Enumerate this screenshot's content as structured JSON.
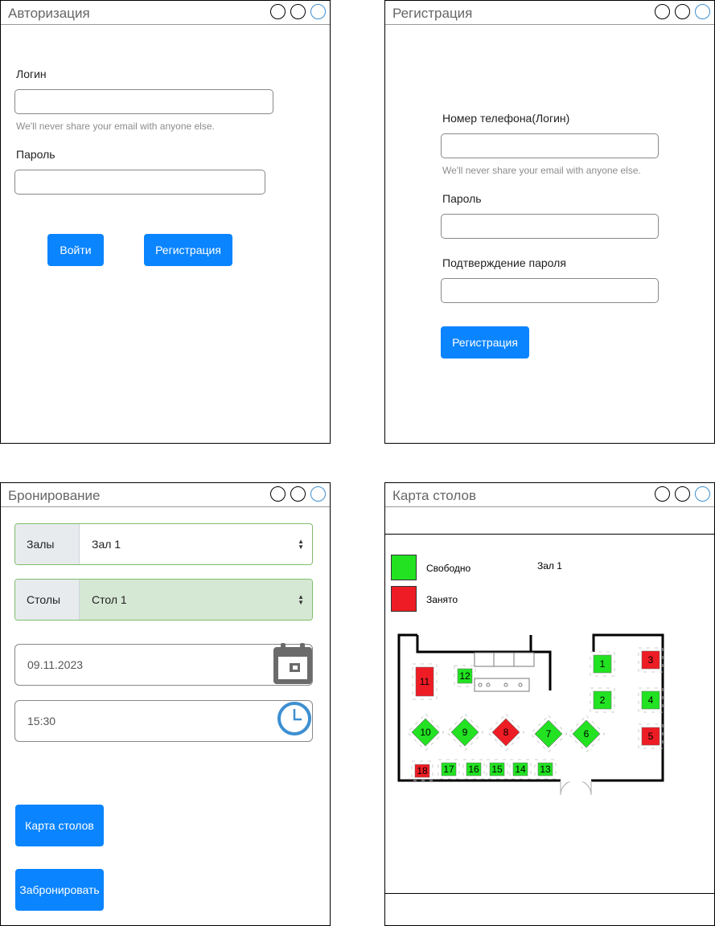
{
  "login": {
    "title": "Авторизация",
    "login_label": "Логин",
    "login_value": "",
    "hint": "We'll never share your email with anyone else.",
    "password_label": "Пароль",
    "password_value": "",
    "submit": "Войти",
    "register": "Регистрация"
  },
  "register": {
    "title": "Регистрация",
    "phone_label": "Номер телефона(Логин)",
    "phone_value": "",
    "hint": "We'll never share your email with anyone else.",
    "password_label": "Пароль",
    "password_value": "",
    "confirm_label": "Подтверждение пароля",
    "confirm_value": "",
    "submit": "Регистрация"
  },
  "booking": {
    "title": "Бронирование",
    "hall_label": "Залы",
    "hall_value": "Зал 1",
    "table_label": "Столы",
    "table_value": "Стол 1",
    "date": "09.11.2023",
    "time": "15:30",
    "map_button": "Карта столов",
    "book_button": "Забронировать"
  },
  "table_map": {
    "title": "Карта столов",
    "hall": "Зал 1",
    "legend": [
      {
        "label": "Свободно",
        "color": "#22e222"
      },
      {
        "label": "Занято",
        "color": "#ee1c24"
      }
    ],
    "tables": [
      {
        "num": "1",
        "status": "free"
      },
      {
        "num": "2",
        "status": "free"
      },
      {
        "num": "3",
        "status": "busy"
      },
      {
        "num": "4",
        "status": "free"
      },
      {
        "num": "5",
        "status": "busy"
      },
      {
        "num": "6",
        "status": "free"
      },
      {
        "num": "7",
        "status": "free"
      },
      {
        "num": "8",
        "status": "busy"
      },
      {
        "num": "9",
        "status": "free"
      },
      {
        "num": "10",
        "status": "free"
      },
      {
        "num": "11",
        "status": "busy"
      },
      {
        "num": "12",
        "status": "free"
      },
      {
        "num": "13",
        "status": "free"
      },
      {
        "num": "14",
        "status": "free"
      },
      {
        "num": "15",
        "status": "free"
      },
      {
        "num": "16",
        "status": "free"
      },
      {
        "num": "17",
        "status": "free"
      },
      {
        "num": "18",
        "status": "busy"
      }
    ]
  },
  "colors": {
    "primary": "#0a84ff",
    "free": "#22e222",
    "busy": "#ee1c24",
    "accent_border": "#7fbf6a",
    "selected_bg": "#d5e8d4"
  },
  "icons": [
    "calendar-icon",
    "clock-icon",
    "caret-updown-icon"
  ]
}
